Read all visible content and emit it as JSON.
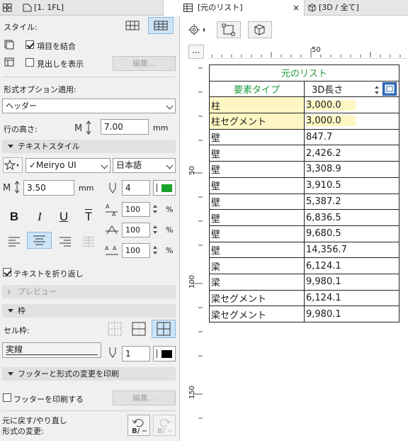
{
  "left_tabs": [
    "",
    "[1. 1FL]"
  ],
  "right_tabs": [
    "[元のリスト]",
    "[3D / 全て]"
  ],
  "style_label": "スタイル:",
  "merge_items": "項目を結合",
  "show_headings": "見出しを表示",
  "edit_label": "編集...",
  "format_option_label": "形式オプション適用:",
  "format_option_value": "ヘッダー",
  "row_height_label": "行の高さ:",
  "row_height_value": "7.00",
  "mm_unit": "mm",
  "text_style_section": "テキストスタイル",
  "font_name": "✓Meiryo UI",
  "language": "日本語",
  "font_size": "3.50",
  "font_size_unit": "mm",
  "pen_number": "4",
  "pen_color": "#1aa12a",
  "bold_label": "B",
  "italic_label": "I",
  "underline_label": "U",
  "strike_label": "T",
  "spacing_values": [
    "100",
    "100",
    "100"
  ],
  "percent": "%",
  "wrap_text": "テキストを折り返し",
  "preview_section": "プレビュー",
  "frame_section": "枠",
  "cell_frame_label": "セル枠:",
  "line_type": "実線",
  "frame_pen": "1",
  "frame_pen_color": "#000000",
  "footer_section": "フッターと形式の変更を印刷",
  "print_footer": "フッターを印刷する",
  "undo_label_1": "元に戻す/やり直し",
  "undo_label_2": "形式の変更:",
  "ruler_label_50": "50",
  "ruler_v_labels": [
    "50",
    "100",
    "150"
  ],
  "ruler_dots_button": "...",
  "schedule": {
    "title": "元のリスト",
    "col1_header": "要素タイプ",
    "col2_header": "3D長さ",
    "rows": [
      {
        "type": "柱",
        "length": "3,000.0",
        "highlight": true
      },
      {
        "type": "柱セグメント",
        "length": "3,000.0",
        "highlight": true
      },
      {
        "type": "壁",
        "length": "847.7",
        "highlight": false
      },
      {
        "type": "壁",
        "length": "2,426.2",
        "highlight": false
      },
      {
        "type": "壁",
        "length": "3,308.9",
        "highlight": false
      },
      {
        "type": "壁",
        "length": "3,910.5",
        "highlight": false
      },
      {
        "type": "壁",
        "length": "5,387.2",
        "highlight": false
      },
      {
        "type": "壁",
        "length": "6,836.5",
        "highlight": false
      },
      {
        "type": "壁",
        "length": "9,680.5",
        "highlight": false
      },
      {
        "type": "壁",
        "length": "14,356.7",
        "highlight": false
      },
      {
        "type": "梁",
        "length": "6,124.1",
        "highlight": false
      },
      {
        "type": "梁",
        "length": "9,980.1",
        "highlight": false
      },
      {
        "type": "梁セグメント",
        "length": "6,124.1",
        "highlight": false
      },
      {
        "type": "梁セグメント",
        "length": "9,980.1",
        "highlight": false
      }
    ]
  }
}
